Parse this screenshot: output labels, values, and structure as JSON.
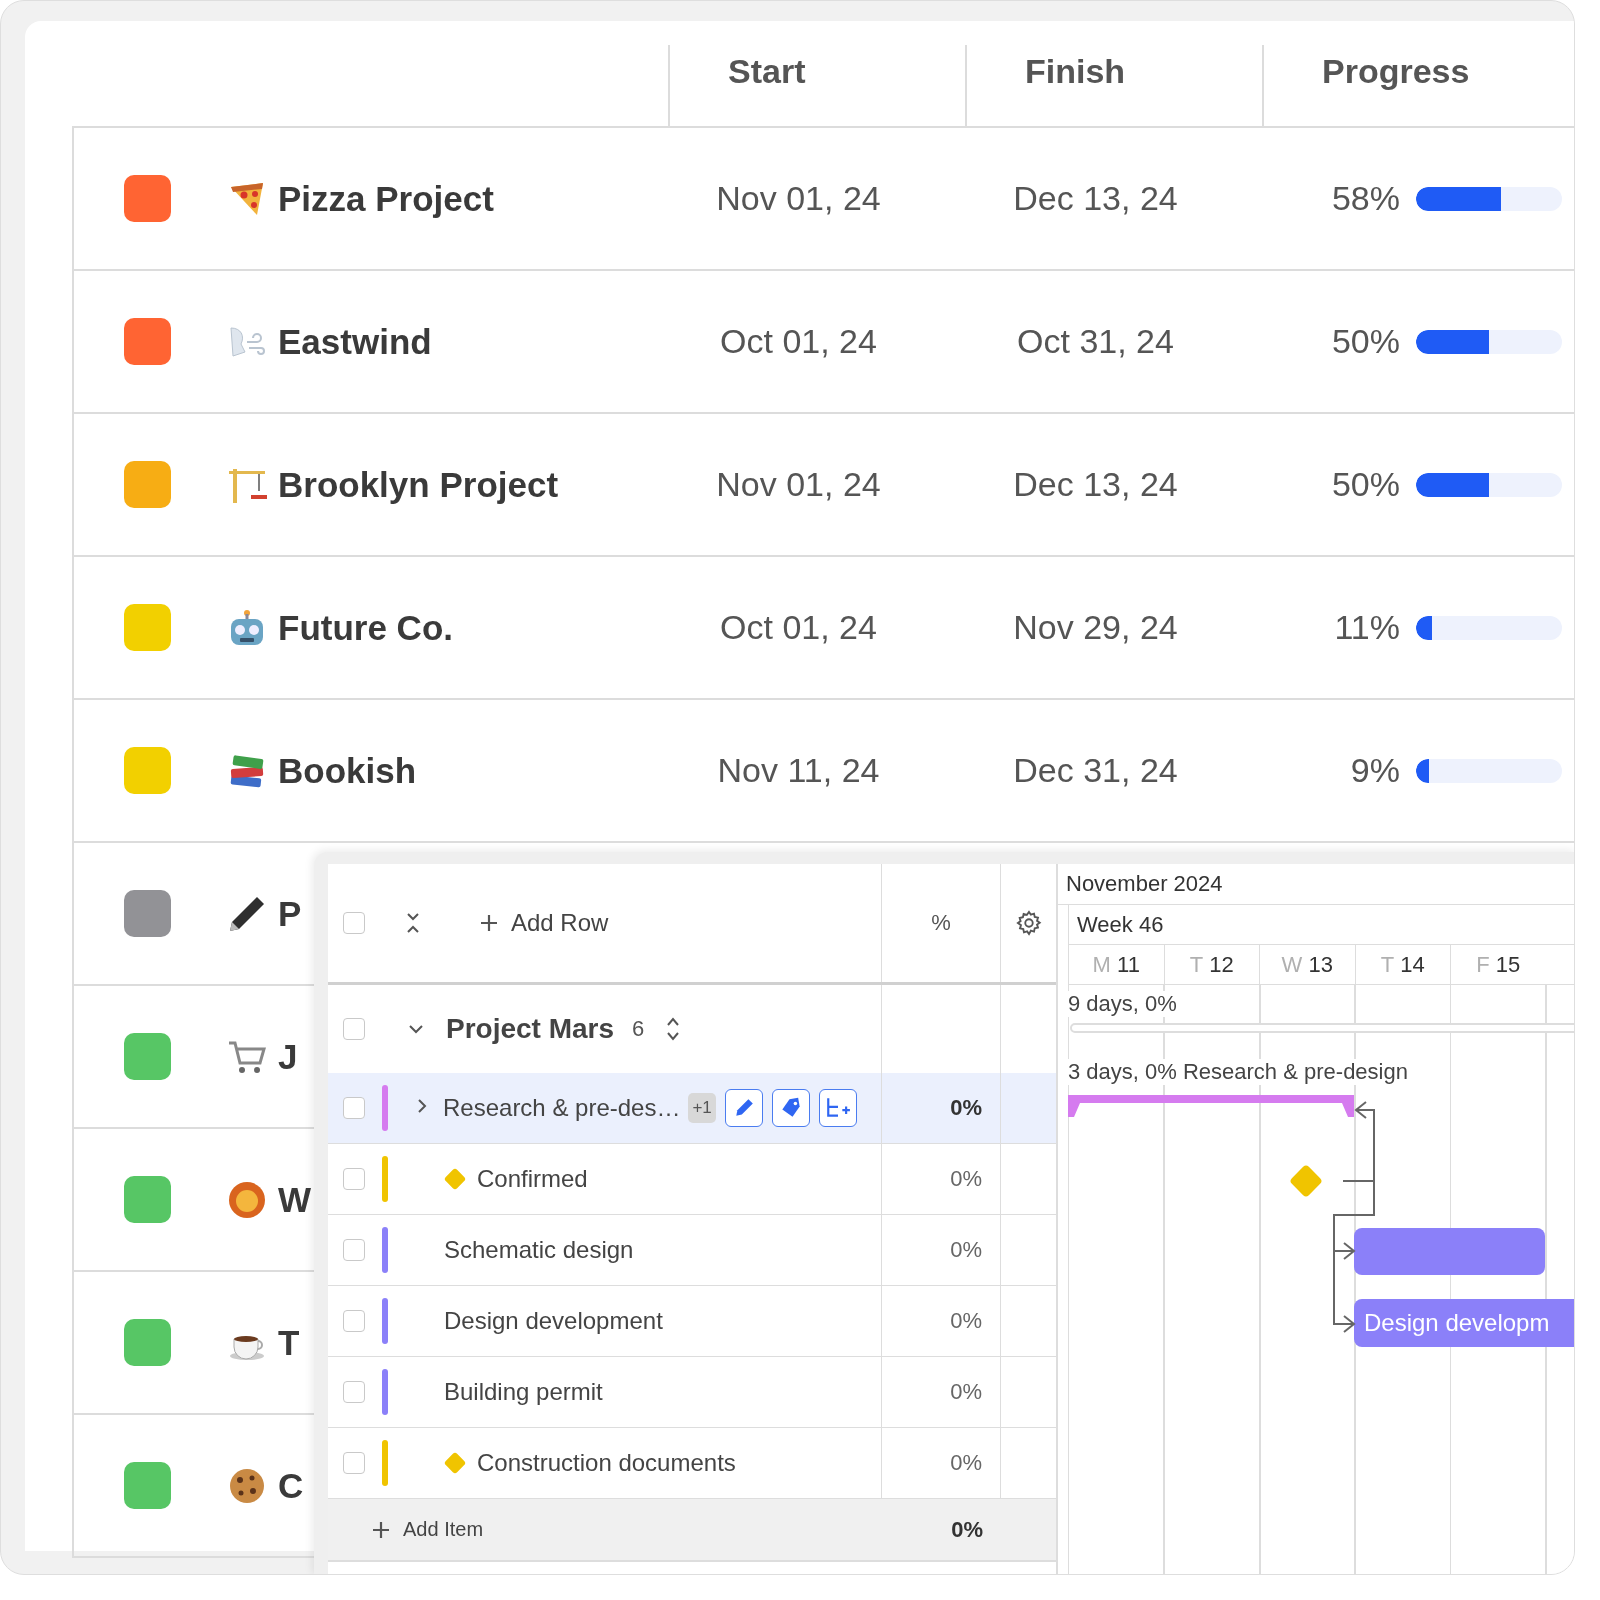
{
  "columns": [
    {
      "label": "Start"
    },
    {
      "label": "Finish"
    },
    {
      "label": "Progress"
    }
  ],
  "projects": [
    {
      "name": "Pizza Project",
      "color": "#ff6433",
      "start": "Nov 01, 24",
      "finish": "Dec 13, 24",
      "progress": "58%",
      "level": 0.58
    },
    {
      "name": "Eastwind",
      "color": "#ff6433",
      "start": "Oct 01, 24",
      "finish": "Oct 31, 24",
      "progress": "50%",
      "level": 0.5
    },
    {
      "name": "Brooklyn Project",
      "color": "#f7ad14",
      "start": "Nov 01, 24",
      "finish": "Dec 13, 24",
      "progress": "50%",
      "level": 0.5
    },
    {
      "name": "Future Co.",
      "color": "#f2d000",
      "start": "Oct 01, 24",
      "finish": "Nov 29, 24",
      "progress": "11%",
      "level": 0.11
    },
    {
      "name": "Bookish",
      "color": "#f2d000",
      "start": "Nov 11, 24",
      "finish": "Dec 31, 24",
      "progress": "9%",
      "level": 0.09
    },
    {
      "name": "P",
      "color": "#929296"
    },
    {
      "name": "J",
      "color": "#57c665"
    },
    {
      "name": "W",
      "color": "#57c665"
    },
    {
      "name": "T",
      "color": "#57c665"
    },
    {
      "name": "C",
      "color": "#57c665"
    }
  ],
  "gantt": {
    "header": {
      "checked": false,
      "add_row": "Add Row",
      "percent": "%"
    },
    "group": {
      "name": "Project Mars",
      "count": "6",
      "checked": false,
      "expanded": true
    },
    "tasks": [
      {
        "name": "Research & pre-des…",
        "kind": "summary",
        "expanded": false,
        "checked": false,
        "selected": true,
        "color": "#d57bef",
        "badge": "+1",
        "percent": "0%"
      },
      {
        "name": "Confirmed",
        "kind": "milestone",
        "checked": false,
        "selected": false,
        "color": "#f0c400",
        "percent": "0%"
      },
      {
        "name": "Schematic design",
        "kind": "task",
        "checked": false,
        "selected": false,
        "color": "#8b80f9",
        "percent": "0%"
      },
      {
        "name": "Design development",
        "kind": "task",
        "checked": false,
        "selected": false,
        "color": "#8b80f9",
        "percent": "0%"
      },
      {
        "name": "Building permit",
        "kind": "task",
        "checked": false,
        "selected": false,
        "color": "#8b80f9",
        "percent": "0%"
      },
      {
        "name": "Construction documents",
        "kind": "milestone",
        "checked": false,
        "selected": false,
        "color": "#f0c400",
        "percent": "0%"
      }
    ],
    "footer": {
      "add_item": "Add Item",
      "percent": "0%"
    },
    "timeline": {
      "month": "November 2024",
      "week": "Week 46",
      "days": [
        {
          "weekday": "M",
          "day": "11"
        },
        {
          "weekday": "T",
          "day": "12"
        },
        {
          "weekday": "W",
          "day": "13"
        },
        {
          "weekday": "T",
          "day": "14"
        },
        {
          "weekday": "F",
          "day": "15"
        }
      ],
      "bars": [
        {
          "kind": "summary",
          "label": "9 days, 0%"
        },
        {
          "kind": "bracket",
          "label": "3 days, 0% Research & pre-design",
          "color": "#d57bef"
        },
        {
          "kind": "milestone",
          "color": "#f0c400"
        },
        {
          "kind": "bar",
          "color": "#8b80f9"
        },
        {
          "kind": "bar",
          "label": "Design developm",
          "color": "#8b80f9"
        }
      ]
    }
  }
}
